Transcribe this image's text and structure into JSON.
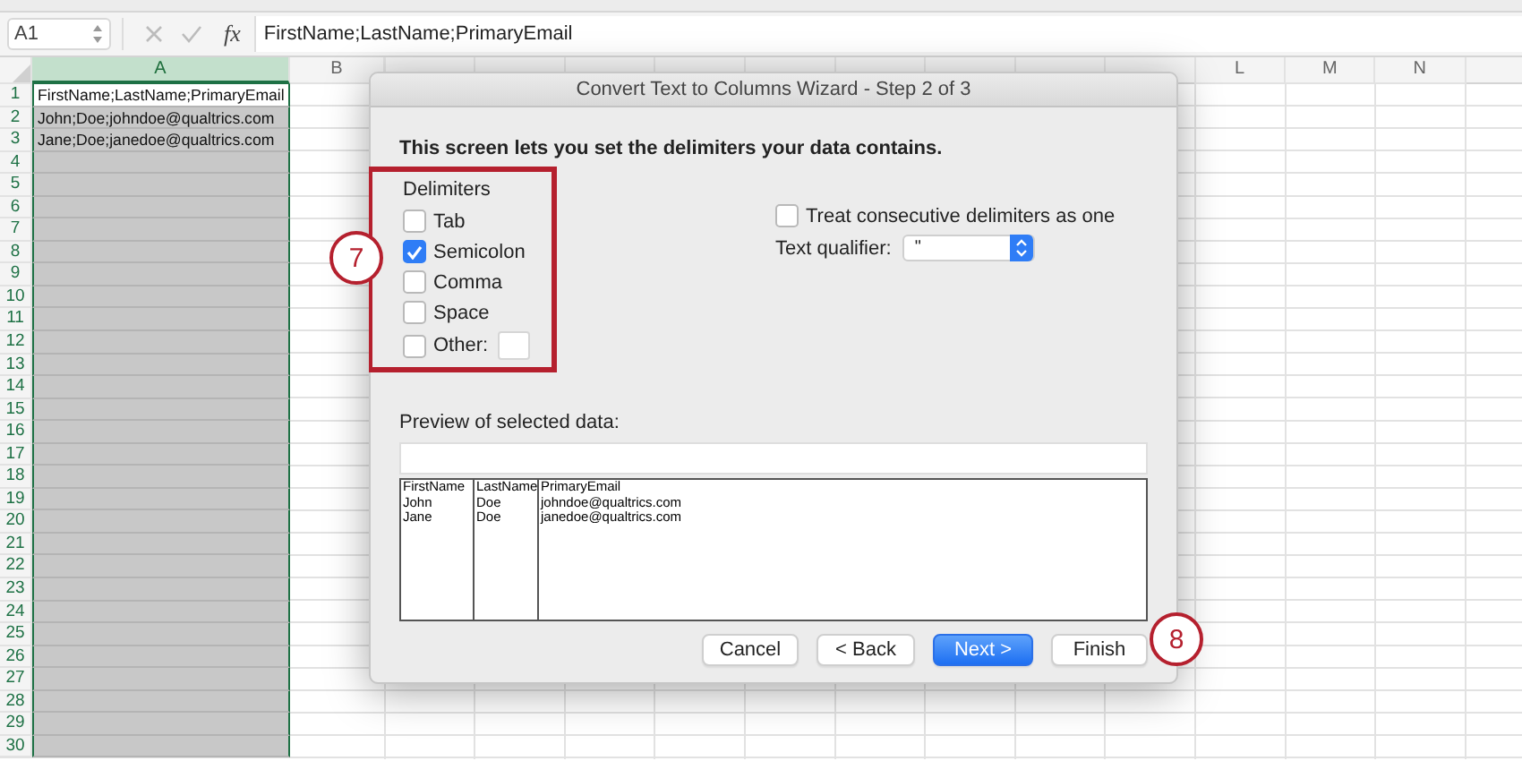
{
  "formula_bar": {
    "cell_ref": "A1",
    "function_label": "fx",
    "formula": "FirstName;LastName;PrimaryEmail"
  },
  "sheet": {
    "columns": [
      {
        "label": "A",
        "selected": true
      },
      {
        "label": "B",
        "selected": false
      },
      {
        "label": "L",
        "selected": false
      },
      {
        "label": "M",
        "selected": false
      },
      {
        "label": "N",
        "selected": false
      }
    ],
    "rows": [
      {
        "number": "1",
        "cell": "FirstName;LastName;PrimaryEmail",
        "active": true
      },
      {
        "number": "2",
        "cell": "John;Doe;johndoe@qualtrics.com",
        "active": false
      },
      {
        "number": "3",
        "cell": "Jane;Doe;janedoe@qualtrics.com",
        "active": false
      },
      {
        "number": "4",
        "active": false
      },
      {
        "number": "5",
        "active": false
      },
      {
        "number": "6",
        "active": false
      },
      {
        "number": "7",
        "active": false
      },
      {
        "number": "8",
        "active": false
      },
      {
        "number": "9",
        "active": false
      },
      {
        "number": "10",
        "active": false
      },
      {
        "number": "11",
        "active": false
      },
      {
        "number": "12",
        "active": false
      },
      {
        "number": "13",
        "active": false
      },
      {
        "number": "14",
        "active": false
      },
      {
        "number": "15",
        "active": false
      },
      {
        "number": "16",
        "active": false
      },
      {
        "number": "17",
        "active": false
      },
      {
        "number": "18",
        "active": false
      },
      {
        "number": "19",
        "active": false
      },
      {
        "number": "20",
        "active": false
      },
      {
        "number": "21",
        "active": false
      },
      {
        "number": "22",
        "active": false
      },
      {
        "number": "23",
        "active": false
      },
      {
        "number": "24",
        "active": false
      },
      {
        "number": "25",
        "active": false
      },
      {
        "number": "26",
        "active": false
      },
      {
        "number": "27",
        "active": false
      },
      {
        "number": "28",
        "active": false
      },
      {
        "number": "29",
        "active": false
      },
      {
        "number": "30",
        "active": false
      }
    ]
  },
  "dialog": {
    "title": "Convert Text to Columns Wizard - Step 2 of 3",
    "instruction": "This screen lets you set the delimiters your data contains.",
    "delimiters": {
      "label": "Delimiters",
      "options": [
        {
          "label": "Tab",
          "checked": false
        },
        {
          "label": "Semicolon",
          "checked": true
        },
        {
          "label": "Comma",
          "checked": false
        },
        {
          "label": "Space",
          "checked": false
        },
        {
          "label": "Other:",
          "checked": false,
          "kind": "with-field"
        }
      ]
    },
    "consecutive": {
      "label": "Treat consecutive delimiters as one",
      "checked": false
    },
    "text_qualifier": {
      "label": "Text qualifier:",
      "value": "\""
    },
    "preview": {
      "label": "Preview of selected data:",
      "rows": [
        [
          "FirstName",
          "LastName",
          "PrimaryEmail"
        ],
        [
          "John",
          "Doe",
          "johndoe@qualtrics.com"
        ],
        [
          "Jane",
          "Doe",
          "janedoe@qualtrics.com"
        ]
      ]
    },
    "buttons": [
      {
        "label": "Cancel",
        "kind": "normal"
      },
      {
        "label": "< Back",
        "kind": "normal"
      },
      {
        "label": "Next >",
        "kind": "default"
      },
      {
        "label": "Finish",
        "kind": "normal"
      }
    ]
  },
  "callouts": [
    {
      "number": "7"
    },
    {
      "number": "8"
    }
  ]
}
